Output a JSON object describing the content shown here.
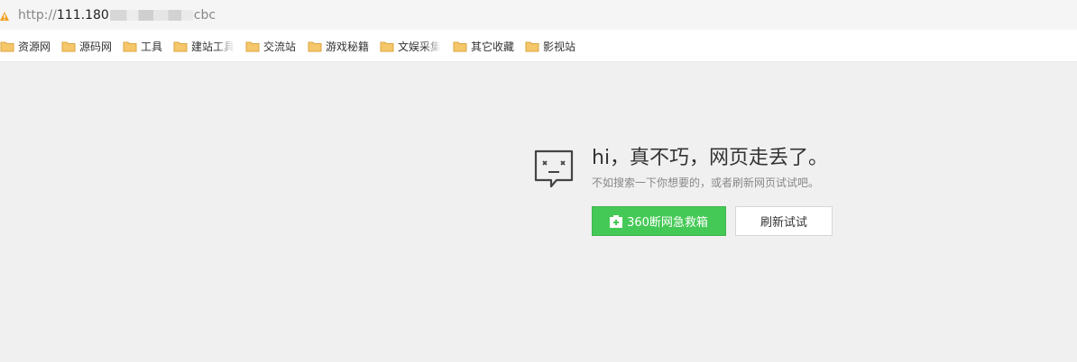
{
  "address_bar": {
    "url_prefix": "http://",
    "url_host": "111.180",
    "url_suffix": "cbc"
  },
  "bookmarks": [
    {
      "label": "资源网"
    },
    {
      "label": "源码网"
    },
    {
      "label": "工具"
    },
    {
      "label": "建站工具"
    },
    {
      "label": "交流站"
    },
    {
      "label": "游戏秘籍"
    },
    {
      "label": "文娱采集"
    },
    {
      "label": "其它收藏"
    },
    {
      "label": "影视站"
    }
  ],
  "error_page": {
    "title": "hi，真不巧，网页走丢了。",
    "subtitle": "不如搜索一下你想要的，或者刷新网页试试吧。",
    "rescue_button": "360断网急救箱",
    "refresh_button": "刷新试试"
  },
  "colors": {
    "rescue_green": "#45c956",
    "folder_yellow": "#f6c76a",
    "warning_orange": "#f0a020"
  }
}
